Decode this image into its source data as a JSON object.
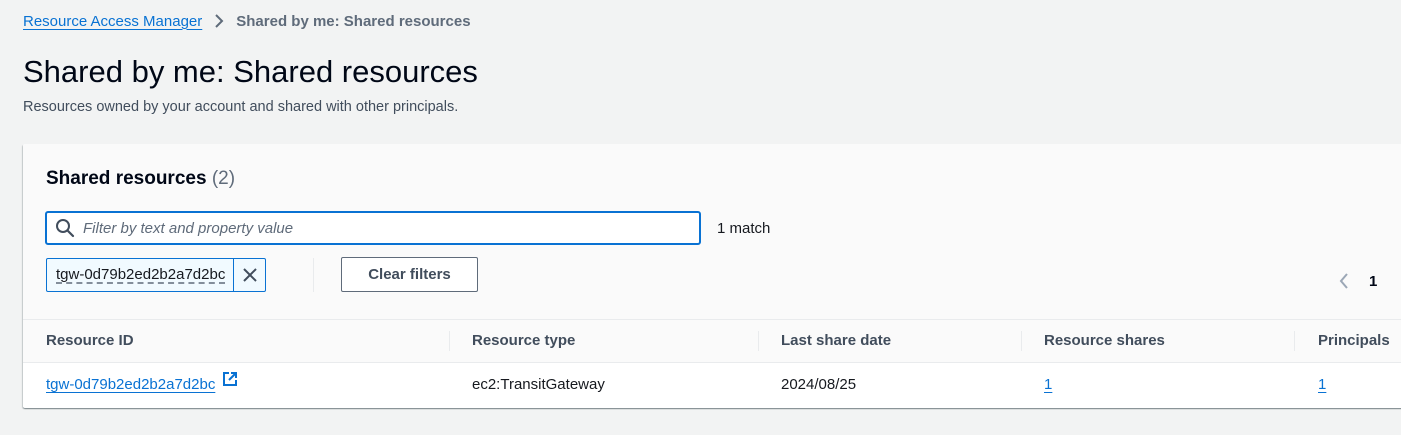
{
  "breadcrumb": {
    "parent": "Resource Access Manager",
    "current": "Shared by me: Shared resources"
  },
  "header": {
    "title": "Shared by me: Shared resources",
    "description": "Resources owned by your account and shared with other principals."
  },
  "panel": {
    "title": "Shared resources",
    "count": "(2)",
    "search_placeholder": "Filter by text and property value",
    "search_value": "",
    "match_count": "1 match",
    "filter_token": "tgw-0d79b2ed2b2a7d2bc",
    "clear_filters_label": "Clear filters",
    "current_page": "1"
  },
  "table": {
    "columns": [
      "Resource ID",
      "Resource type",
      "Last share date",
      "Resource shares",
      "Principals"
    ],
    "rows": [
      {
        "resource_id": "tgw-0d79b2ed2b2a7d2bc",
        "resource_type": "ec2:TransitGateway",
        "last_share_date": "2024/08/25",
        "resource_shares": "1",
        "principals": "1"
      }
    ]
  },
  "colors": {
    "link": "#0972d3",
    "background": "#f2f3f3",
    "text": "#16191f"
  },
  "icons": {
    "breadcrumb_separator": "chevron-right-icon",
    "search": "search-icon",
    "token_dismiss": "close-icon",
    "pagination_prev": "chevron-left-icon",
    "external_link": "external-link-icon"
  }
}
